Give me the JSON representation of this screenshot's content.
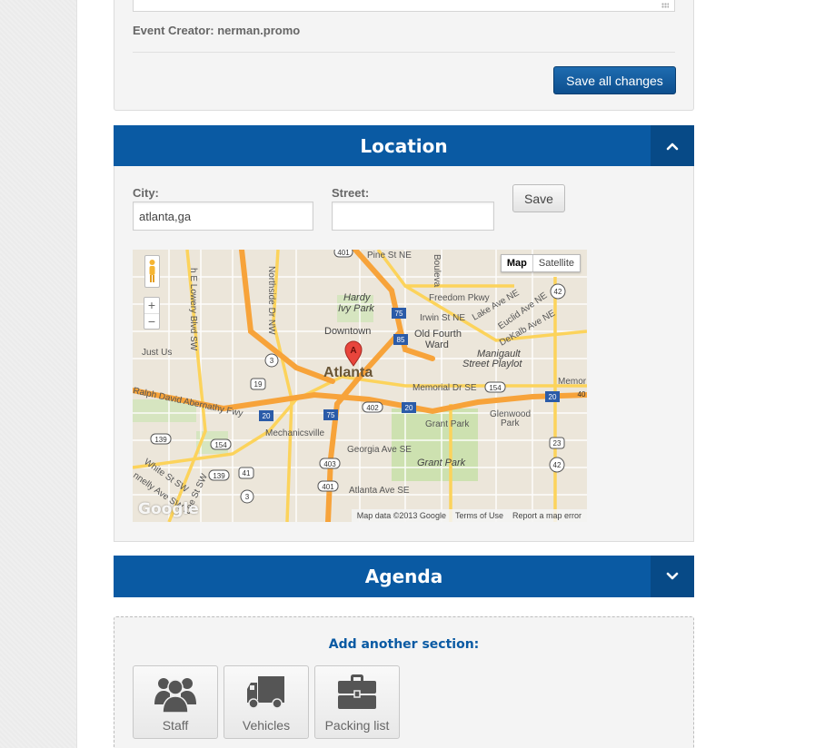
{
  "event": {
    "creator_text": "Event Creator: nerman.promo",
    "save_all_label": "Save all changes"
  },
  "location": {
    "title": "Location",
    "city_label": "City:",
    "city_value": "atlanta,ga",
    "street_label": "Street:",
    "street_value": "",
    "save_label": "Save",
    "map": {
      "type_map": "Map",
      "type_satellite": "Satellite",
      "zoom_in": "+",
      "zoom_out": "−",
      "attribution_data": "Map data ©2013 Google",
      "attribution_terms": "Terms of Use",
      "attribution_report": "Report a map error",
      "logo": "Google",
      "marker_label": "A",
      "labels": {
        "atlanta": "Atlanta",
        "downtown": "Downtown",
        "hardy_ivy_park": "Hardy Ivy Park",
        "hardy": "Hardy",
        "ivy_park": "Ivy Park",
        "old_fourth_ward": "Old Fourth",
        "ward": "Ward",
        "pine_st": "Pine St NE",
        "freedom_pkwy": "Freedom Pkwy",
        "irwin_st": "Irwin St NE",
        "lake_ave": "Lake Ave NE",
        "euclid_ave": "Euclid Ave NE",
        "dekalb_ave": "DeKalb Ave NE",
        "manigault": "Manigault",
        "street_playlot": "Street Playlot",
        "memorial_dr": "Memorial Dr SE",
        "memorial_right": "Memor",
        "grant_park": "Grant Park",
        "grant_park_2": "Grant Park",
        "glenwood": "Glenwood",
        "park": "Park",
        "georgia_ave": "Georgia Ave SE",
        "atlanta_ave": "Atlanta Ave SE",
        "mechanicsville": "Mechanicsville",
        "abernathy": "Ralph David Abernathy Fwy",
        "white_st": "White St SW",
        "nelly_ave": "nnelly Ave SW",
        "lee_st": "Lee St SW",
        "just_us": "Just Us",
        "lowery": "h E Lowery Blvd SW",
        "northside": "Northside Dr NW",
        "boulevard": "Bouleva",
        "shield_401": "401",
        "shield_75a": "75",
        "shield_85": "85",
        "shield_3a": "3",
        "shield_19": "19",
        "shield_20a": "20",
        "shield_75b": "75",
        "shield_402": "402",
        "shield_20b": "20",
        "shield_154a": "154",
        "shield_20c": "20",
        "shield_42a": "42",
        "shield_40": "40",
        "shield_139a": "139",
        "shield_154b": "154",
        "shield_139b": "139",
        "shield_41": "41",
        "shield_3b": "3",
        "shield_403": "403",
        "shield_401b": "401",
        "shield_23": "23",
        "shield_42b": "42"
      }
    }
  },
  "agenda": {
    "title": "Agenda"
  },
  "add_section": {
    "title": "Add another section:",
    "tiles": [
      {
        "label": "Staff",
        "icon": "users-icon"
      },
      {
        "label": "Vehicles",
        "icon": "truck-icon"
      },
      {
        "label": "Packing list",
        "icon": "briefcase-icon"
      }
    ]
  },
  "colors": {
    "header_blue": "#0a5aa3",
    "header_toggle_blue": "#074a87",
    "button_blue": "#1e6cb0",
    "highway_orange": "#f7a33a",
    "map_background": "#ece6da",
    "park_green": "#cde1b0"
  }
}
